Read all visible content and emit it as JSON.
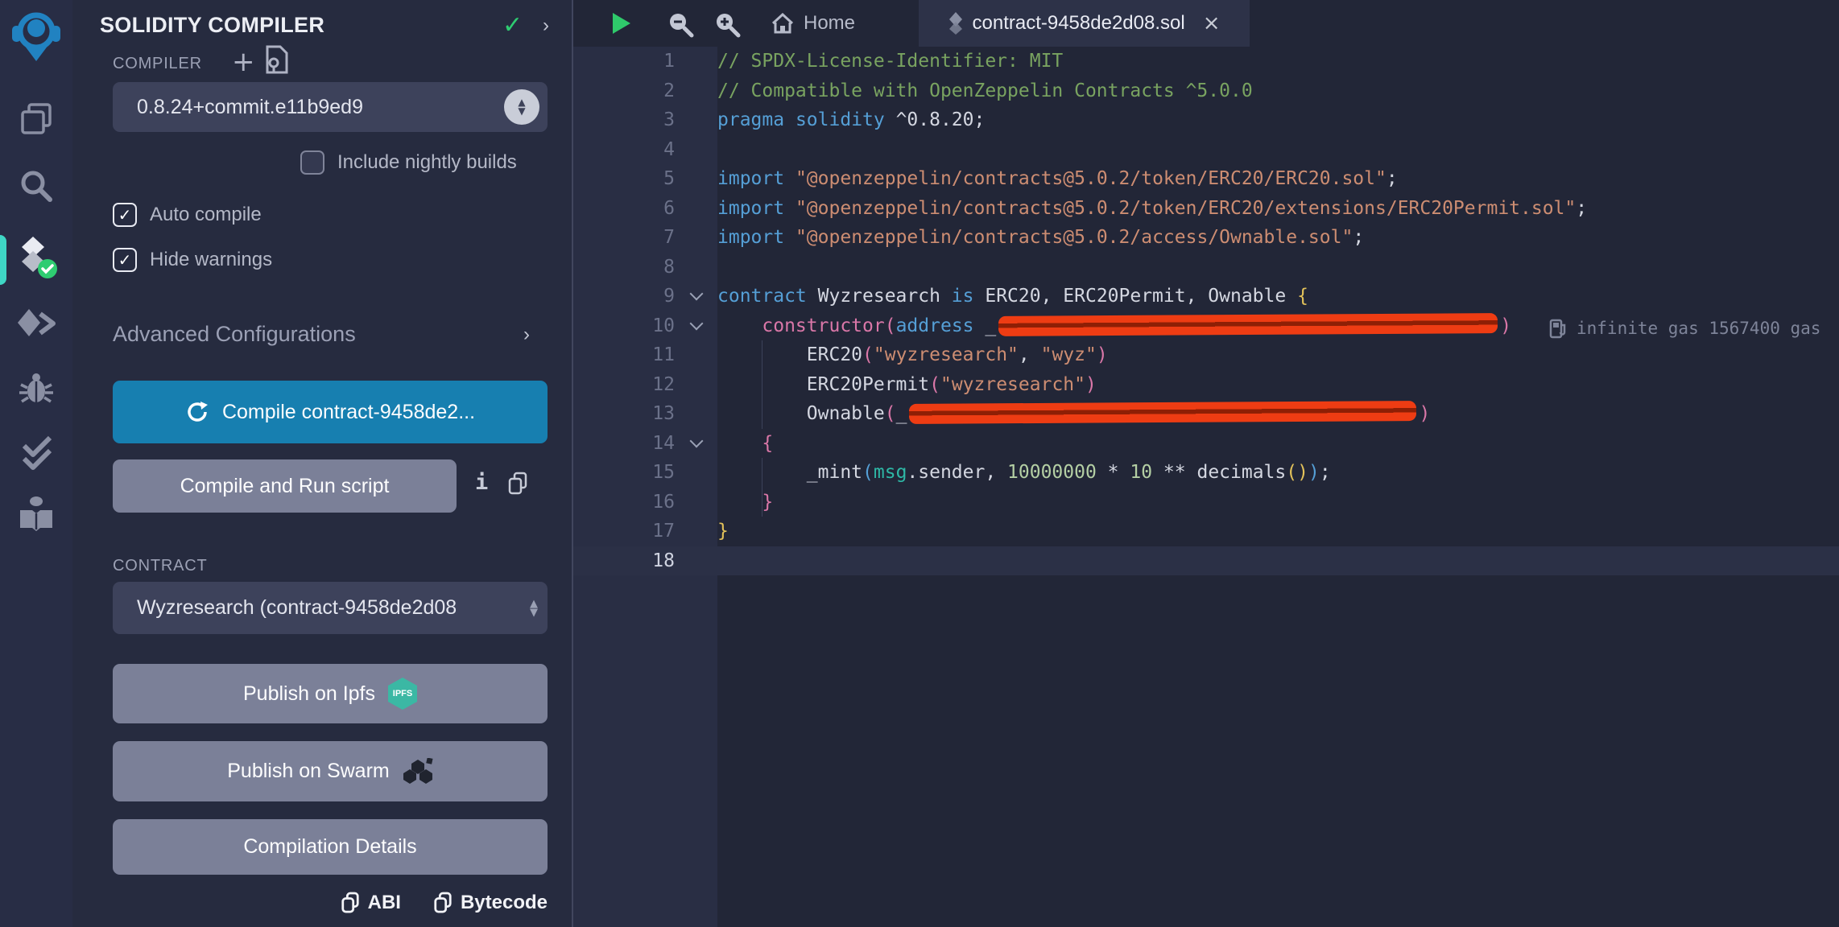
{
  "icon_sidebar": {
    "active_plugin": "solidity-compiler",
    "icons": [
      "remix-logo",
      "file-explorer-icon",
      "search-icon",
      "solidity-compiler-icon",
      "deploy-run-icon",
      "debugger-icon",
      "unit-testing-icon",
      "learneth-icon"
    ]
  },
  "panel": {
    "title": "SOLIDITY COMPILER",
    "compiler_label": "COMPILER",
    "version": "0.8.24+commit.e11b9ed9",
    "nightly_label": "Include nightly builds",
    "auto_compile_label": "Auto compile",
    "hide_warnings_label": "Hide warnings",
    "advanced_label": "Advanced Configurations",
    "compile_button": "Compile contract-9458de2...",
    "compile_run_button": "Compile and Run script",
    "contract_label": "CONTRACT",
    "contract_value": "Wyzresearch (contract-9458de2d08",
    "publish_ipfs": "Publish on Ipfs",
    "ipfs_badge": "IPFS",
    "publish_swarm": "Publish on Swarm",
    "compilation_details": "Compilation Details",
    "abi_label": "ABI",
    "bytecode_label": "Bytecode",
    "checkbox_states": {
      "nightly": false,
      "auto_compile": true,
      "hide_warnings": true
    },
    "icons": {
      "plus": "+",
      "info": "i",
      "chevron_right": "›",
      "check": "✓"
    }
  },
  "editor": {
    "tabs": [
      {
        "label": "Home",
        "active": false
      },
      {
        "label": "contract-9458de2d08.sol",
        "active": true
      }
    ],
    "close_glyph": "×",
    "gas_annotation": "infinite gas 1567400 gas",
    "lines": [
      {
        "n": 1,
        "seg": [
          [
            "cm",
            "// SPDX-License-Identifier: MIT"
          ]
        ]
      },
      {
        "n": 2,
        "seg": [
          [
            "cm",
            "// Compatible with OpenZeppelin Contracts ^5.0.0"
          ]
        ]
      },
      {
        "n": 3,
        "seg": [
          [
            "kw",
            "pragma"
          ],
          [
            "pl",
            " "
          ],
          [
            "kw",
            "solidity"
          ],
          [
            "pl",
            " ^0.8.20;"
          ]
        ]
      },
      {
        "n": 4,
        "seg": []
      },
      {
        "n": 5,
        "seg": [
          [
            "kw",
            "import"
          ],
          [
            "pl",
            " "
          ],
          [
            "str",
            "\"@openzeppelin/contracts@5.0.2/token/ERC20/ERC20.sol\""
          ],
          [
            "pl",
            ";"
          ]
        ]
      },
      {
        "n": 6,
        "seg": [
          [
            "kw",
            "import"
          ],
          [
            "pl",
            " "
          ],
          [
            "str",
            "\"@openzeppelin/contracts@5.0.2/token/ERC20/extensions/ERC20Permit.sol\""
          ],
          [
            "pl",
            ";"
          ]
        ]
      },
      {
        "n": 7,
        "seg": [
          [
            "kw",
            "import"
          ],
          [
            "pl",
            " "
          ],
          [
            "str",
            "\"@openzeppelin/contracts@5.0.2/access/Ownable.sol\""
          ],
          [
            "pl",
            ";"
          ]
        ]
      },
      {
        "n": 8,
        "seg": []
      },
      {
        "n": 9,
        "fold": true,
        "seg": [
          [
            "kw",
            "contract"
          ],
          [
            "pl",
            " Wyzresearch "
          ],
          [
            "kw",
            "is"
          ],
          [
            "pl",
            " ERC20, ERC20Permit, Ownable "
          ],
          [
            "by",
            "{"
          ]
        ]
      },
      {
        "n": 10,
        "fold": true,
        "seg": [
          [
            "pl",
            "    "
          ],
          [
            "ctor",
            "constructor"
          ],
          [
            "pk",
            "("
          ],
          [
            "kw",
            "address"
          ],
          [
            "pl",
            " _"
          ],
          [
            "redact",
            620
          ],
          [
            "pk",
            ")"
          ]
        ]
      },
      {
        "n": 11,
        "guide": true,
        "seg": [
          [
            "pl",
            "        ERC20"
          ],
          [
            "pk",
            "("
          ],
          [
            "str",
            "\"wyzresearch\""
          ],
          [
            "pl",
            ", "
          ],
          [
            "str",
            "\"wyz\""
          ],
          [
            "pk",
            ")"
          ]
        ]
      },
      {
        "n": 12,
        "guide": true,
        "seg": [
          [
            "pl",
            "        ERC20Permit"
          ],
          [
            "pk",
            "("
          ],
          [
            "str",
            "\"wyzresearch\""
          ],
          [
            "pk",
            ")"
          ]
        ]
      },
      {
        "n": 13,
        "guide": true,
        "seg": [
          [
            "pl",
            "        Ownable"
          ],
          [
            "pk",
            "("
          ],
          [
            "pl",
            "_"
          ],
          [
            "redact",
            630
          ],
          [
            "pk",
            ")"
          ]
        ]
      },
      {
        "n": 14,
        "fold": true,
        "seg": [
          [
            "pk",
            "    {"
          ]
        ]
      },
      {
        "n": 15,
        "guide": true,
        "seg": [
          [
            "pl",
            "        _mint"
          ],
          [
            "bb",
            "("
          ],
          [
            "teal",
            "msg"
          ],
          [
            "pl",
            ".sender, "
          ],
          [
            "num",
            "10000000"
          ],
          [
            "pl",
            " * "
          ],
          [
            "num",
            "10"
          ],
          [
            "pl",
            " ** decimals"
          ],
          [
            "by",
            "()"
          ],
          [
            "bb",
            ")"
          ],
          [
            "pl",
            ";"
          ]
        ]
      },
      {
        "n": 16,
        "guide": true,
        "seg": [
          [
            "pk",
            "    }"
          ]
        ]
      },
      {
        "n": 17,
        "seg": [
          [
            "by",
            "}"
          ]
        ]
      },
      {
        "n": 18,
        "current": true,
        "seg": []
      }
    ]
  },
  "colors": {
    "accent_primary": "#177fb0",
    "success_green": "#2ecc71",
    "redaction_red": "#ee3c13",
    "active_indicator": "#3fd6c5",
    "ipfs_teal": "#3bb8a4"
  }
}
